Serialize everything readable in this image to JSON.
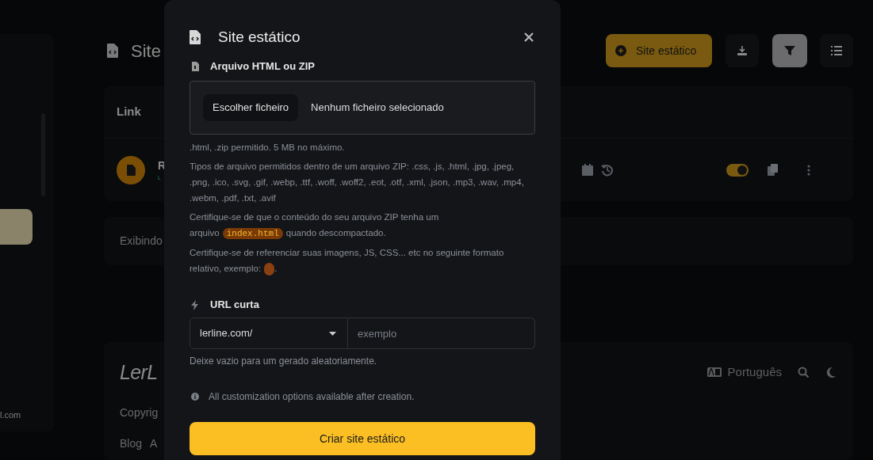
{
  "sidebar": {
    "footer_text": "l.com"
  },
  "page": {
    "title": "Site",
    "create_button": "Site estático",
    "table": {
      "header": "Link",
      "rows": [
        {
          "name": "R",
          "link": "L",
          "enabled": true
        }
      ]
    },
    "pagination": "Exibindo",
    "footer": {
      "logo": "LerL",
      "language": "Português",
      "copyright": "Copyrig",
      "links": [
        "Blog",
        "A"
      ]
    }
  },
  "modal": {
    "title": "Site estático",
    "file_section": {
      "label": "Arquivo HTML ou ZIP",
      "button": "Escolher ficheiro",
      "status": "Nenhum ficheiro selecionado",
      "help": [
        [
          {
            "kind": "text",
            "text": ".html, .zip permitido. 5 MB no máximo."
          }
        ],
        [
          {
            "kind": "text",
            "text": "Tipos de arquivo permitidos dentro de um arquivo ZIP: .css, .js, .html, .jpg, .jpeg, .png, .ico, .svg, .gif, .webp, .ttf, .woff, .woff2, .eot, .otf, .xml, .json, .mp3, .wav, .mp4, .webm, .pdf, .txt, .avif"
          }
        ],
        [
          {
            "kind": "text",
            "text": "Certifique-se de que o conteúdo do seu arquivo ZIP tenha um arquivo"
          },
          {
            "kind": "code",
            "text": "index.html"
          },
          {
            "kind": "text",
            "text": "quando descompactado."
          }
        ],
        [
          {
            "kind": "text",
            "text": "Certifique-se de referenciar suas imagens, JS, CSS... etc no seguinte formato relativo, exemplo:"
          },
          {
            "kind": "blank_code"
          },
          {
            "kind": "text",
            "text": "."
          }
        ]
      ]
    },
    "url_section": {
      "label": "URL curta",
      "domain": "lerline.com/",
      "placeholder": "exemplo",
      "help": "Deixe vazio para um gerado aleatoriamente."
    },
    "info": "All customization options available after creation.",
    "submit": "Criar site estático"
  }
}
